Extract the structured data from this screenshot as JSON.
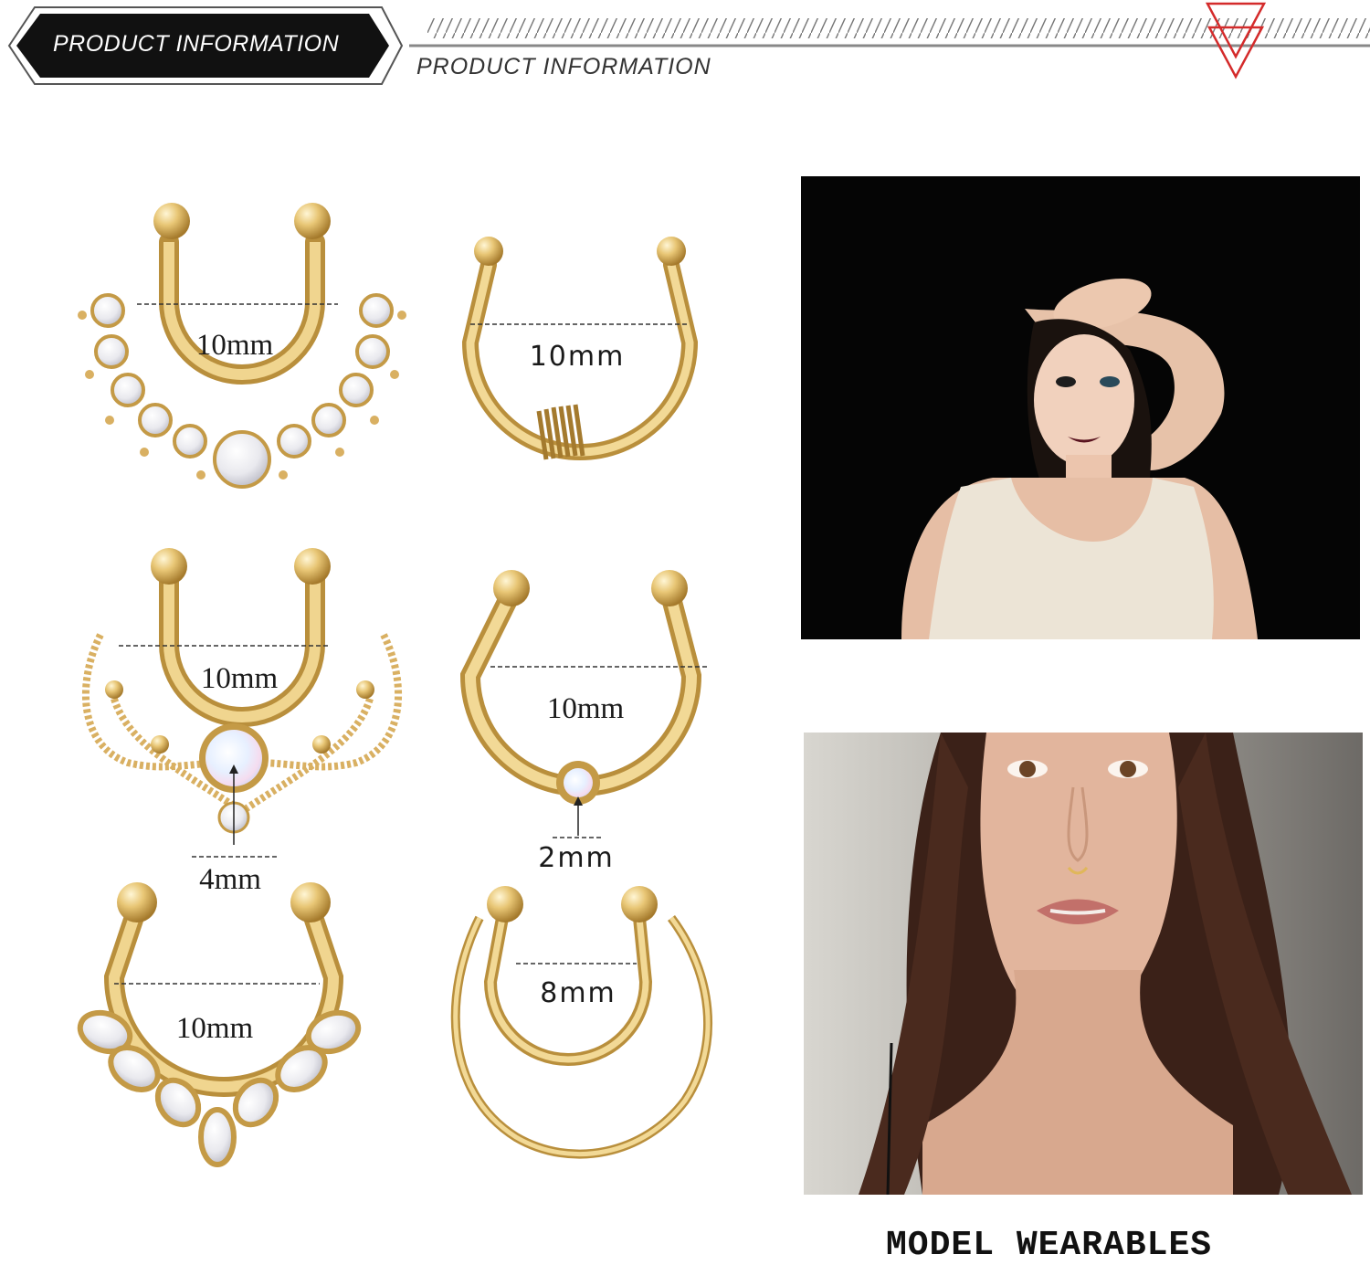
{
  "header": {
    "badge_text": "PRODUCT  INFORMATION",
    "subtitle": "PRODUCT  INFORMATION"
  },
  "products": [
    {
      "size_label": "10mm"
    },
    {
      "size_label": "10mm"
    },
    {
      "size_label": "10mm",
      "gem_label": "4mm"
    },
    {
      "size_label": "10mm",
      "gem_label": "2mm"
    },
    {
      "size_label": "10mm"
    },
    {
      "size_label": "8mm"
    }
  ],
  "caption": "MODEL WEARABLES",
  "colors": {
    "gold": "#e4c277",
    "gold_dark": "#b98f3c",
    "gold_light": "#fbeab3",
    "accent_red": "#d42b2b",
    "badge_black": "#111111"
  }
}
